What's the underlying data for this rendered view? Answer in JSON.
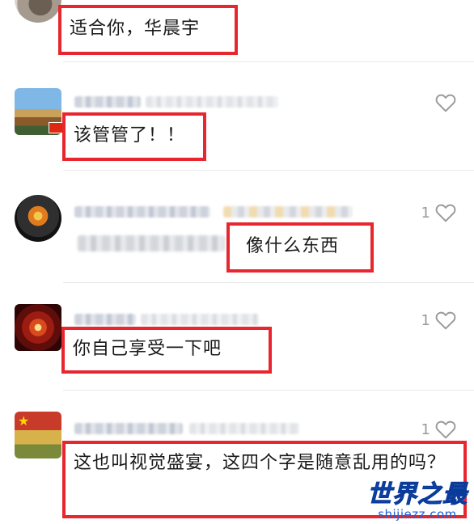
{
  "comments": [
    {
      "text": "适合你，华晨宇"
    },
    {
      "text": "该管管了！！",
      "likes": ""
    },
    {
      "text": "像什么东西",
      "likes": "1"
    },
    {
      "text": "你自己享受一下吧",
      "likes": "1"
    },
    {
      "text": "这也叫视觉盛宴，这四个字是随意乱用的吗？",
      "likes": "1"
    }
  ],
  "icons": {
    "like": "heart-outline-icon"
  },
  "colors": {
    "highlight_border": "#e8262f",
    "watermark_blue": "#1e5fd6",
    "like_gray": "#9a9a9a"
  },
  "watermark": {
    "title": "世界之最",
    "url": "shijiezz.com"
  }
}
